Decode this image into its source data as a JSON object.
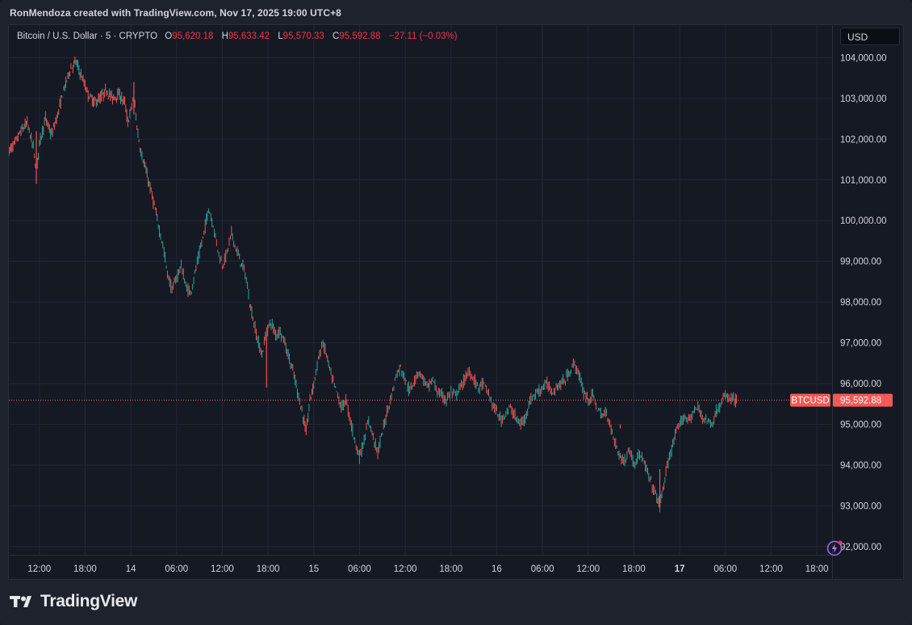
{
  "attribution": "RonMendoza created with TradingView.com, Nov 17, 2025 19:00 UTC+8",
  "legend": {
    "symbol": "Bitcoin / U.S. Dollar · 5 · CRYPTO",
    "o_label": "O",
    "o_value": "95,620.18",
    "h_label": "H",
    "h_value": "95,633.42",
    "l_label": "L",
    "l_value": "95,570.33",
    "c_label": "C",
    "c_value": "95,592.88",
    "change": "−27.11 (−0.03%)"
  },
  "currency": "USD",
  "brand": "TradingView",
  "colors": {
    "background": "#151924",
    "grid": "#232735",
    "up": "#26a69a",
    "down": "#ef5350",
    "price_tag": "#f25a57",
    "axis_text": "#d1d4dc"
  },
  "chart_data": {
    "type": "candlestick-line",
    "symbol": "BTCUSD",
    "interval": "5",
    "y_ticks": [
      104000,
      103000,
      102000,
      101000,
      100000,
      99000,
      98000,
      97000,
      96000,
      95000,
      94000,
      93000,
      92000
    ],
    "y_tick_labels": [
      "104,000.00",
      "103,000.00",
      "102,000.00",
      "101,000.00",
      "100,000.00",
      "99,000.00",
      "98,000.00",
      "97,000.00",
      "96,000.00",
      "95,000.00",
      "94,000.00",
      "93,000.00",
      "92,000.00"
    ],
    "ylim": [
      91800,
      104800
    ],
    "x_hours": [
      0,
      6,
      12,
      18,
      24,
      30,
      36,
      42,
      48,
      54,
      60,
      66,
      72,
      78,
      84,
      90,
      96,
      102,
      108
    ],
    "x_tick_labels": [
      "12:00",
      "18:00",
      "14",
      "06:00",
      "12:00",
      "18:00",
      "15",
      "06:00",
      "12:00",
      "18:00",
      "16",
      "06:00",
      "12:00",
      "18:00",
      "17",
      "06:00",
      "12:00",
      "18:00"
    ],
    "x_tick_hours": [
      12,
      18,
      24,
      30,
      36,
      42,
      48,
      54,
      60,
      66,
      72,
      78,
      84,
      90,
      96,
      102,
      108,
      114
    ],
    "x_tick_bold": [
      false,
      false,
      false,
      false,
      false,
      false,
      false,
      false,
      false,
      false,
      false,
      false,
      false,
      false,
      true,
      false,
      false,
      false
    ],
    "xlim_hours": [
      8,
      116
    ],
    "price_path": [
      [
        8.0,
        101700
      ],
      [
        8.8,
        101900
      ],
      [
        9.6,
        102200
      ],
      [
        10.4,
        102400
      ],
      [
        11.2,
        101800
      ],
      [
        11.6,
        101200
      ],
      [
        12.0,
        101900
      ],
      [
        12.8,
        102500
      ],
      [
        13.6,
        102100
      ],
      [
        14.4,
        102600
      ],
      [
        15.2,
        103200
      ],
      [
        16.0,
        103700
      ],
      [
        16.8,
        103900
      ],
      [
        17.6,
        103500
      ],
      [
        18.4,
        103100
      ],
      [
        19.2,
        102900
      ],
      [
        20.0,
        103000
      ],
      [
        20.8,
        103200
      ],
      [
        21.6,
        103000
      ],
      [
        22.4,
        103100
      ],
      [
        23.2,
        102900
      ],
      [
        23.6,
        102400
      ],
      [
        24.0,
        102700
      ],
      [
        24.4,
        103100
      ],
      [
        24.8,
        102300
      ],
      [
        25.2,
        101800
      ],
      [
        26.0,
        101200
      ],
      [
        26.8,
        100600
      ],
      [
        27.6,
        99900
      ],
      [
        28.2,
        99400
      ],
      [
        28.8,
        98700
      ],
      [
        29.4,
        98300
      ],
      [
        30.0,
        98600
      ],
      [
        30.6,
        98900
      ],
      [
        31.2,
        98400
      ],
      [
        31.8,
        98200
      ],
      [
        32.4,
        98700
      ],
      [
        33.0,
        99200
      ],
      [
        33.6,
        99700
      ],
      [
        34.2,
        100300
      ],
      [
        34.8,
        99900
      ],
      [
        35.4,
        99300
      ],
      [
        36.0,
        98900
      ],
      [
        36.6,
        99200
      ],
      [
        37.2,
        99700
      ],
      [
        37.8,
        99300
      ],
      [
        38.4,
        99000
      ],
      [
        39.0,
        98700
      ],
      [
        39.6,
        98000
      ],
      [
        40.0,
        97600
      ],
      [
        40.6,
        97100
      ],
      [
        41.2,
        96700
      ],
      [
        41.8,
        97300
      ],
      [
        42.4,
        97500
      ],
      [
        43.0,
        97200
      ],
      [
        43.6,
        97300
      ],
      [
        44.2,
        97000
      ],
      [
        44.8,
        96600
      ],
      [
        45.4,
        96200
      ],
      [
        46.0,
        95700
      ],
      [
        46.6,
        95200
      ],
      [
        47.0,
        94800
      ],
      [
        47.5,
        95600
      ],
      [
        48.0,
        96000
      ],
      [
        48.6,
        96600
      ],
      [
        49.2,
        97000
      ],
      [
        49.8,
        96600
      ],
      [
        50.4,
        96100
      ],
      [
        51.0,
        95800
      ],
      [
        51.6,
        95400
      ],
      [
        52.2,
        95600
      ],
      [
        52.8,
        95100
      ],
      [
        53.4,
        94600
      ],
      [
        54.0,
        94200
      ],
      [
        54.6,
        94600
      ],
      [
        55.2,
        95100
      ],
      [
        55.8,
        94700
      ],
      [
        56.4,
        94300
      ],
      [
        57.0,
        94800
      ],
      [
        57.6,
        95300
      ],
      [
        58.2,
        95700
      ],
      [
        58.8,
        96200
      ],
      [
        59.4,
        96400
      ],
      [
        60.0,
        96100
      ],
      [
        60.6,
        95800
      ],
      [
        61.2,
        96100
      ],
      [
        61.8,
        96300
      ],
      [
        62.4,
        96100
      ],
      [
        63.0,
        95900
      ],
      [
        63.6,
        96100
      ],
      [
        64.2,
        95800
      ],
      [
        64.8,
        95700
      ],
      [
        65.4,
        95600
      ],
      [
        66.0,
        95800
      ],
      [
        66.6,
        95700
      ],
      [
        67.2,
        95900
      ],
      [
        67.8,
        96100
      ],
      [
        68.4,
        96300
      ],
      [
        69.0,
        96100
      ],
      [
        69.6,
        95900
      ],
      [
        70.2,
        96000
      ],
      [
        70.8,
        95800
      ],
      [
        71.4,
        95500
      ],
      [
        72.0,
        95300
      ],
      [
        72.6,
        95100
      ],
      [
        73.2,
        95300
      ],
      [
        73.8,
        95400
      ],
      [
        74.4,
        95200
      ],
      [
        75.0,
        95000
      ],
      [
        75.6,
        95100
      ],
      [
        76.2,
        95500
      ],
      [
        76.8,
        95700
      ],
      [
        77.4,
        95800
      ],
      [
        78.0,
        95900
      ],
      [
        78.6,
        96000
      ],
      [
        79.2,
        95800
      ],
      [
        79.8,
        95900
      ],
      [
        80.4,
        96000
      ],
      [
        81.0,
        96100
      ],
      [
        81.6,
        96300
      ],
      [
        82.2,
        96500
      ],
      [
        82.8,
        96200
      ],
      [
        83.4,
        95800
      ],
      [
        84.0,
        95600
      ],
      [
        84.6,
        95700
      ],
      [
        85.2,
        95400
      ],
      [
        85.8,
        95200
      ],
      [
        86.4,
        95300
      ],
      [
        87.0,
        94900
      ],
      [
        87.6,
        94500
      ],
      [
        88.2,
        94200
      ],
      [
        88.8,
        94100
      ],
      [
        89.4,
        94400
      ],
      [
        90.0,
        94000
      ],
      [
        90.6,
        94300
      ],
      [
        91.2,
        94100
      ],
      [
        91.8,
        93800
      ],
      [
        92.4,
        93500
      ],
      [
        93.0,
        93200
      ],
      [
        93.4,
        93000
      ],
      [
        93.8,
        93400
      ],
      [
        94.2,
        93800
      ],
      [
        94.8,
        94300
      ],
      [
        95.4,
        94700
      ],
      [
        96.0,
        95000
      ],
      [
        96.6,
        95200
      ],
      [
        97.2,
        95100
      ],
      [
        97.8,
        95300
      ],
      [
        98.4,
        95400
      ],
      [
        99.0,
        95200
      ],
      [
        99.6,
        95100
      ],
      [
        100.2,
        95000
      ],
      [
        100.8,
        95300
      ],
      [
        101.4,
        95500
      ],
      [
        102.0,
        95700
      ],
      [
        102.6,
        95650
      ],
      [
        103.2,
        95600
      ],
      [
        103.6,
        95593
      ]
    ],
    "last_price": 95592.88,
    "last_label": "95,592.88",
    "last_symbol_label": "BTCUSD"
  }
}
